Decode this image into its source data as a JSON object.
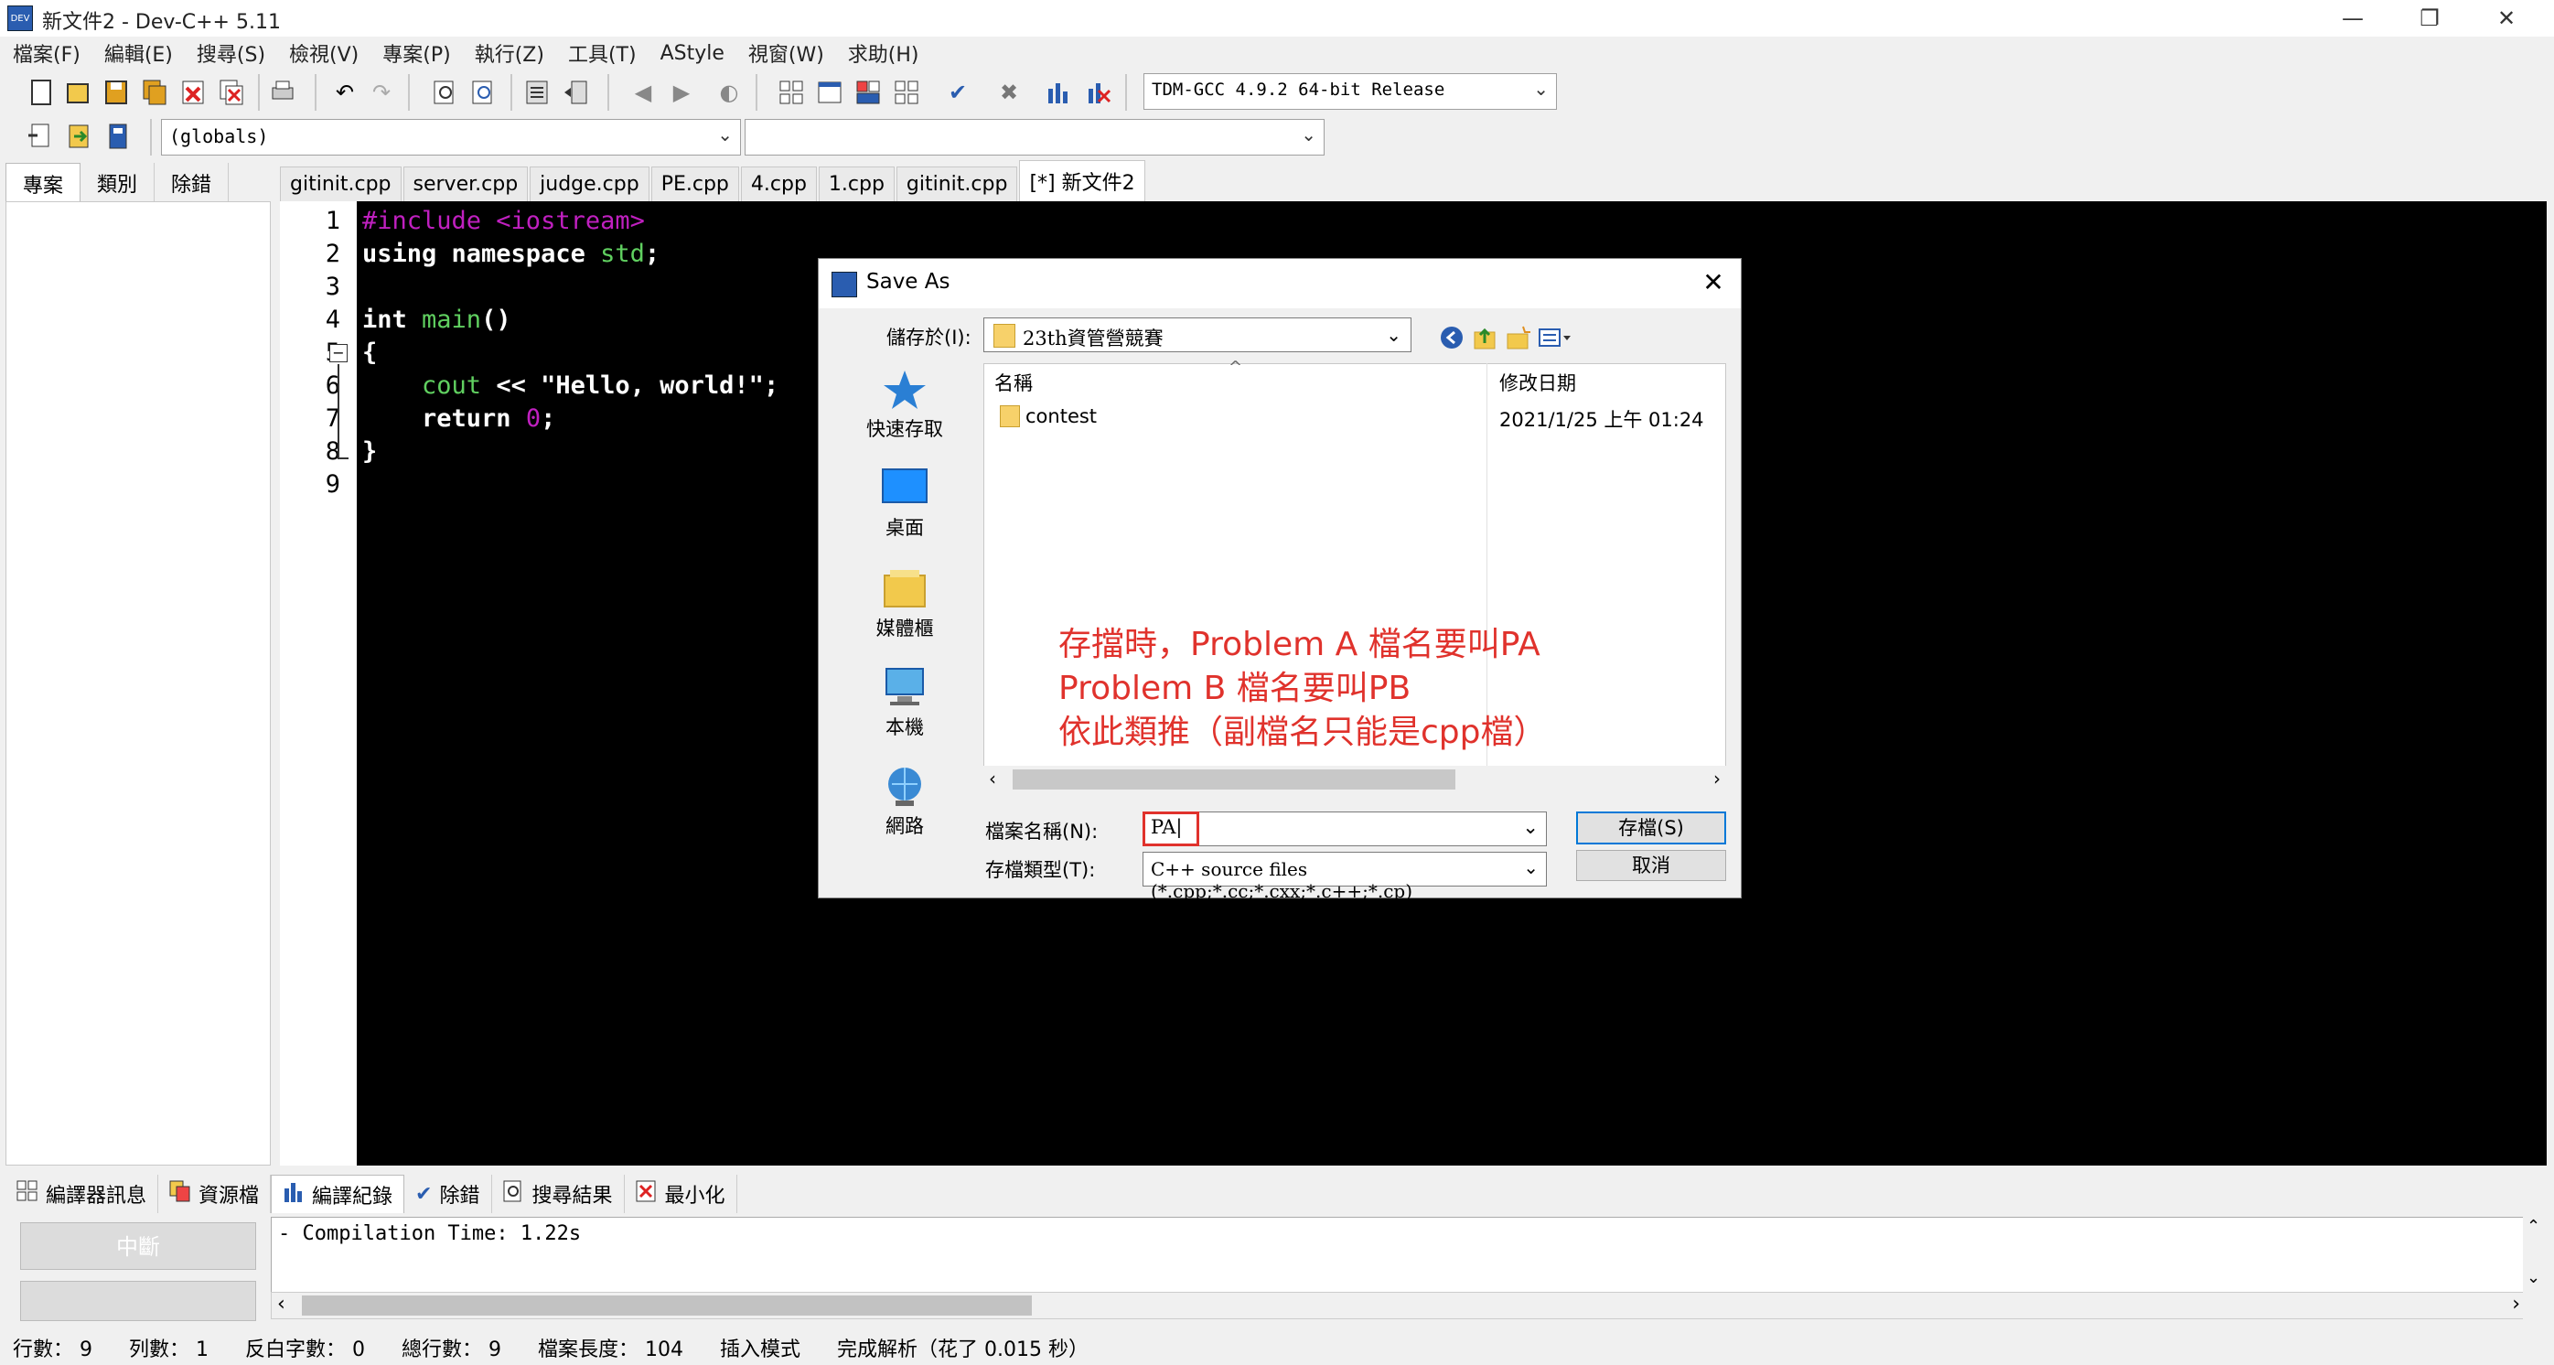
{
  "window": {
    "title": "新文件2 - Dev-C++ 5.11",
    "minimize": "—",
    "restore": "❐",
    "close": "✕"
  },
  "menu": [
    "檔案(F)",
    "編輯(E)",
    "搜尋(S)",
    "檢視(V)",
    "專案(P)",
    "執行(Z)",
    "工具(T)",
    "AStyle",
    "視窗(W)",
    "求助(H)"
  ],
  "toolbar": {
    "compiler": "TDM-GCC 4.9.2 64-bit Release",
    "scope": "(globals)",
    "symbol": ""
  },
  "left_tabs": [
    "專案",
    "類別",
    "除錯"
  ],
  "editor_tabs": [
    "gitinit.cpp",
    "server.cpp",
    "judge.cpp",
    "PE.cpp",
    "4.cpp",
    "1.cpp",
    "gitinit.cpp",
    "[*] 新文件2"
  ],
  "line_numbers": [
    "1",
    "2",
    "3",
    "4",
    "5",
    "6",
    "7",
    "8",
    "9"
  ],
  "code": {
    "l1": "#include <iostream>",
    "l2a": "using namespace ",
    "l2b": "std",
    "l2c": ";",
    "l4a": "int ",
    "l4b": "main",
    "l4c": "()",
    "l5": "{",
    "l6a": "    ",
    "l6b": "cout",
    "l6c": " << ",
    "l6d": "\"Hello, world!\"",
    "l6e": ";",
    "l7a": "    return ",
    "l7b": "0",
    "l7c": ";",
    "l8": "}"
  },
  "bottom_tabs": [
    "編譯器訊息",
    "資源檔",
    "編譯紀錄",
    "除錯",
    "搜尋結果",
    "最小化"
  ],
  "abort_label": "中斷",
  "log_text": "- Compilation Time: 1.22s",
  "status": {
    "line": "行數：   9",
    "col": "列數：   1",
    "sel": "反白字數：   0",
    "total": "總行數：   9",
    "length": "檔案長度：  104",
    "mode": "插入模式",
    "parse": "完成解析（花了 0.015 秒）"
  },
  "dialog": {
    "title": "Save As",
    "save_in_label": "儲存於(I):",
    "save_in_value": "23th資管營競賽",
    "places": [
      "快速存取",
      "桌面",
      "媒體櫃",
      "本機",
      "網路"
    ],
    "col_name": "名稱",
    "col_date": "修改日期",
    "files": [
      {
        "name": "contest",
        "date": "2021/1/25 上午 01:24"
      }
    ],
    "filename_label": "檔案名稱(N):",
    "filename_value": "PA|",
    "filetype_label": "存檔類型(T):",
    "filetype_value": "C++ source files (*.cpp;*.cc;*.cxx;*.c++;*.cp)",
    "save_button": "存檔(S)",
    "cancel_button": "取消",
    "annotation": "存擋時，Problem A 檔名要叫PA\nProblem B 檔名要叫PB\n依此類推（副檔名只能是cpp檔）"
  },
  "colors": {
    "accent": "#0078d7",
    "annotation": "#e0322c",
    "editor_bg": "#000000"
  }
}
